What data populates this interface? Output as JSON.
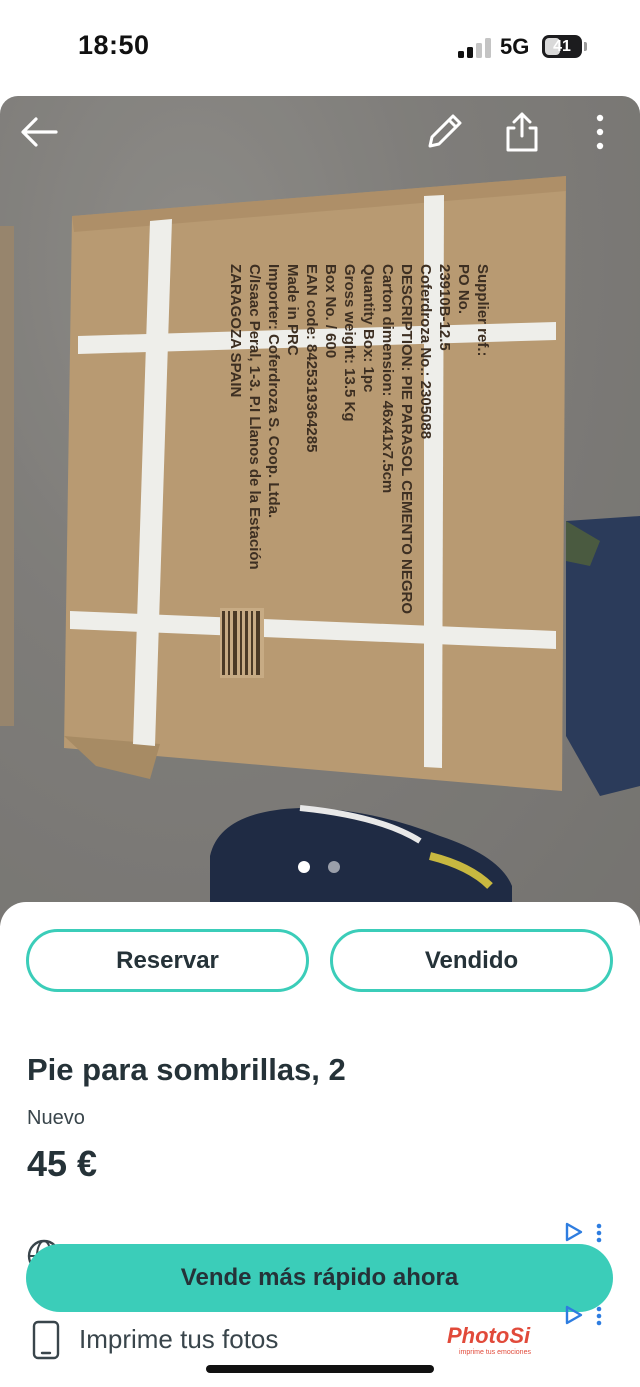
{
  "status_bar": {
    "time": "18:50",
    "network": "5G",
    "battery": "41"
  },
  "photo": {
    "subject": "cardboard box",
    "box_label_lines": [
      "Supplier ref.:",
      "PO No.",
      "23910B-12.5",
      "Coferdroza No.: 2305088",
      "DESCRIPTION: PIE PARASOL CEMENTO NEGRO",
      "Carton dimension: 46x41x7.5cm",
      "Quantity Box: 1pc",
      "Gross weight: 13.5 Kg",
      "Box No. / 600",
      "EAN code: 8425319364285",
      "Made in PRC",
      "Importer: Coferdroza S. Coop. Ltda.",
      "C/Isaac Peral, 1-3. P.I Llanos de la Estación",
      "ZARAGOZA SPAIN"
    ],
    "page_count": 2,
    "current_page": 1,
    "icons": {
      "back": "back-arrow-icon",
      "edit": "pencil-icon",
      "share": "share-icon",
      "more": "more-vertical-icon"
    }
  },
  "actions": {
    "reserve_label": "Reservar",
    "sold_label": "Vendido"
  },
  "product": {
    "title": "Pie para sombrillas, 2",
    "condition": "Nuevo",
    "price": "45 €"
  },
  "promo": {
    "cta_label": "Vende más rápido ahora"
  },
  "ad": {
    "text": "Imprime tus fotos",
    "brand": "PhotoSi",
    "brand_tagline": "imprime tus emociones",
    "icons": [
      "globe-icon",
      "phone-icon",
      "ad-choices-icon"
    ]
  },
  "colors": {
    "accent": "#3bcdb9",
    "text_primary": "#253238",
    "brand_red": "#e14a3a"
  }
}
